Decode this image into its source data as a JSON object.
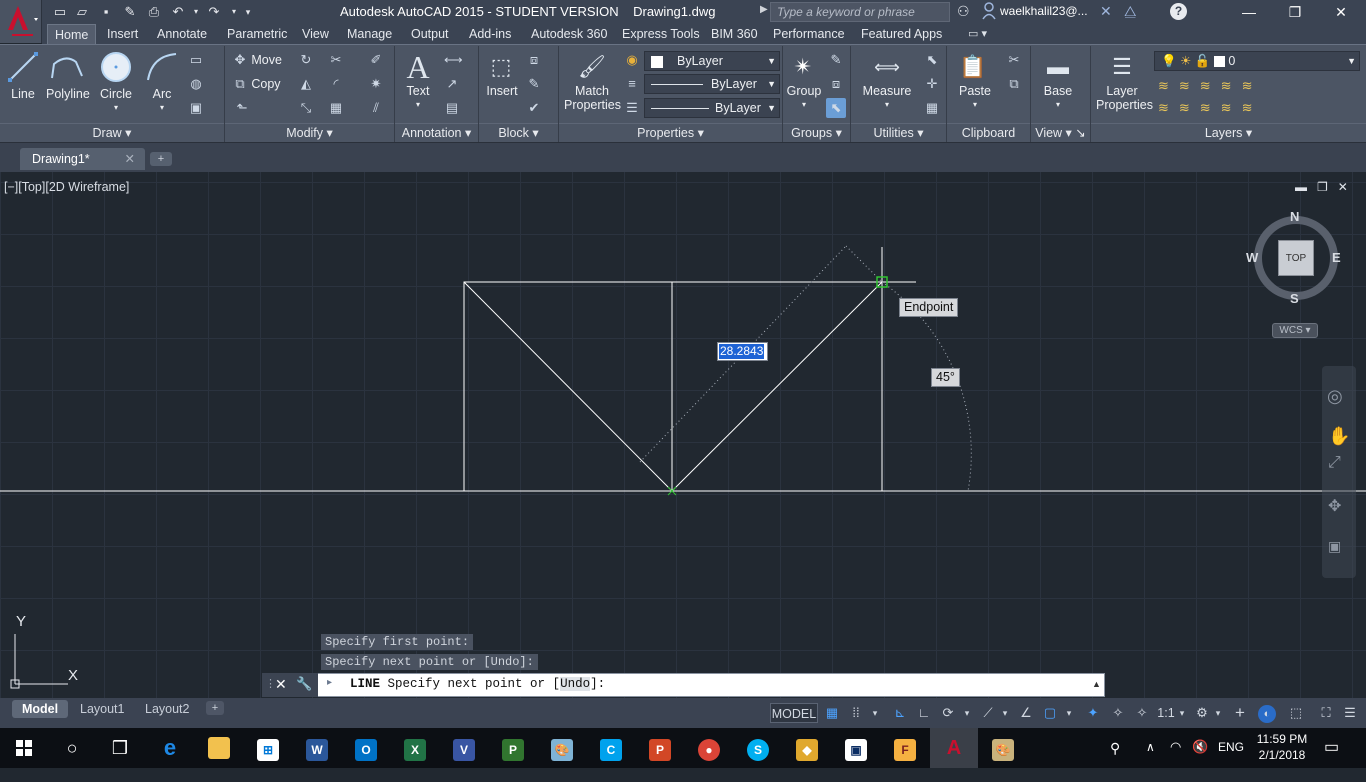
{
  "titlebar": {
    "title": "Autodesk AutoCAD 2015 - STUDENT VERSION    Drawing1.dwg",
    "search_placeholder": "Type a keyword or phrase",
    "user": "waelkhalil23@..."
  },
  "ribbon_tabs": [
    "Home",
    "Insert",
    "Annotate",
    "Parametric",
    "View",
    "Manage",
    "Output",
    "Add-ins",
    "Autodesk 360",
    "Express Tools",
    "BIM 360",
    "Performance",
    "Featured Apps"
  ],
  "ribbon": {
    "draw": {
      "line": "Line",
      "polyline": "Polyline",
      "circle": "Circle",
      "arc": "Arc",
      "footer": "Draw"
    },
    "modify": {
      "move": "Move",
      "copy": "Copy",
      "footer": "Modify"
    },
    "annotation": {
      "text": "Text",
      "footer": "Annotation"
    },
    "block": {
      "insert": "Insert",
      "footer": "Block"
    },
    "properties": {
      "match1": "Match",
      "match2": "Properties",
      "color": "ByLayer",
      "linetype": "ByLayer",
      "lineweight": "ByLayer",
      "footer": "Properties"
    },
    "groups": {
      "group": "Group",
      "footer": "Groups"
    },
    "utilities": {
      "measure": "Measure",
      "footer": "Utilities"
    },
    "clipboard": {
      "paste": "Paste",
      "footer": "Clipboard"
    },
    "view": {
      "base": "Base",
      "footer": "View"
    },
    "layers": {
      "layer_props1": "Layer",
      "layer_props2": "Properties",
      "current_layer": "0",
      "footer": "Layers"
    }
  },
  "document": {
    "tab": "Drawing1*"
  },
  "viewport": {
    "label": "[−][Top][2D Wireframe]",
    "viewcube": {
      "top": "TOP",
      "n": "N",
      "s": "S",
      "e": "E",
      "w": "W",
      "wcs": "WCS"
    },
    "tooltip_snap": "Endpoint",
    "dimension_input": "28.2843",
    "angle_input": "45°",
    "ucs": {
      "x": "X",
      "y": "Y"
    }
  },
  "command": {
    "history": [
      "Specify first point:",
      "Specify next point or [Undo]:"
    ],
    "prompt_cmd": "LINE",
    "prompt_text": "Specify next point or [",
    "prompt_opt": "Undo",
    "prompt_end": "]:"
  },
  "layout_tabs": [
    "Model",
    "Layout1",
    "Layout2"
  ],
  "status": {
    "model": "MODEL",
    "scale": "1:1"
  },
  "taskbar": {
    "lang": "ENG",
    "time": "11:59 PM",
    "date": "2/1/2018"
  },
  "colors": {
    "accent": "#2a6cc8",
    "autocad_red": "#c8102e",
    "canvas": "#212830"
  }
}
